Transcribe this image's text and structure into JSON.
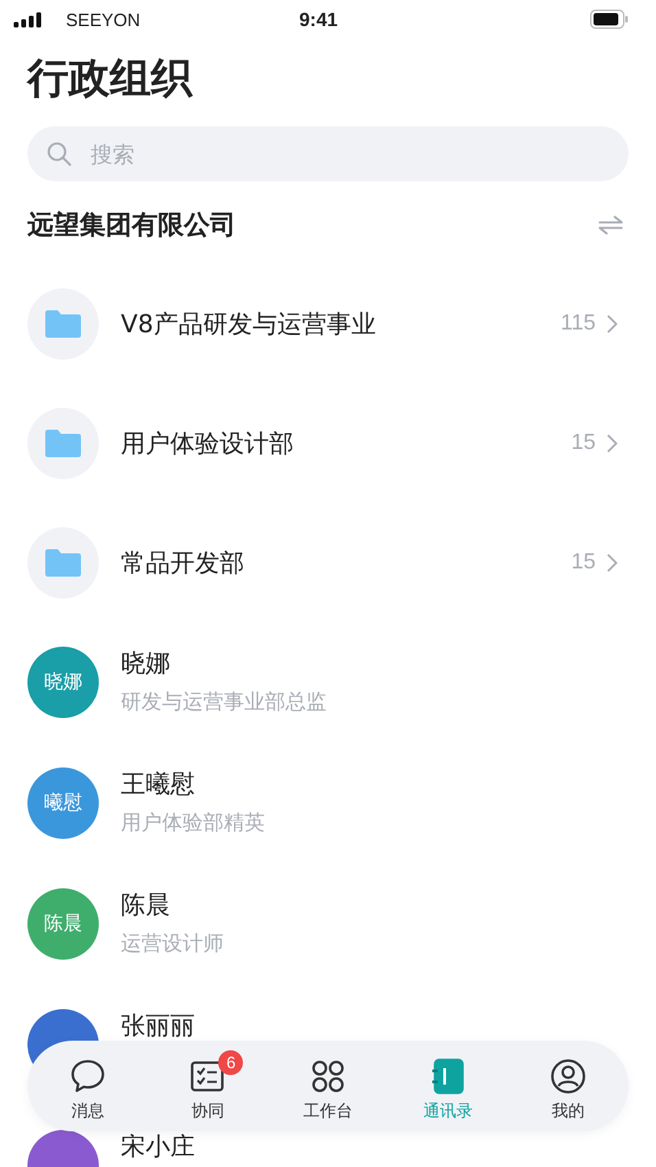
{
  "status_bar": {
    "carrier": "SEEYON",
    "time": "9:41"
  },
  "title": "行政组织",
  "search": {
    "placeholder": "搜索"
  },
  "company": {
    "name": "远望集团有限公司"
  },
  "departments": [
    {
      "name": "V8产品研发与运营事业",
      "count": "115"
    },
    {
      "name": "用户体验设计部",
      "count": "15"
    },
    {
      "name": "常品开发部",
      "count": "15"
    }
  ],
  "people": [
    {
      "name": "晓娜",
      "title": "研发与运营事业部总监",
      "avatar_text": "晓娜",
      "color": "#1a9ea8"
    },
    {
      "name": "王曦慰",
      "title": "用户体验部精英",
      "avatar_text": "曦慰",
      "color": "#3a97dc"
    },
    {
      "name": "陈晨",
      "title": "运营设计师",
      "avatar_text": "陈晨",
      "color": "#3fae6c"
    },
    {
      "name": "张丽丽",
      "color": "#3a6fd0"
    },
    {
      "name": "宋小庄",
      "color": "#8a5bd0"
    }
  ],
  "tab_bar": [
    {
      "kind": "chat",
      "label": "消息",
      "selected": false
    },
    {
      "kind": "tasks",
      "label": "协同",
      "selected": false,
      "badge": "6"
    },
    {
      "kind": "grid",
      "label": "工作台",
      "selected": false
    },
    {
      "kind": "contacts",
      "label": "通讯录",
      "selected": true
    },
    {
      "kind": "profile",
      "label": "我的",
      "selected": false
    }
  ]
}
